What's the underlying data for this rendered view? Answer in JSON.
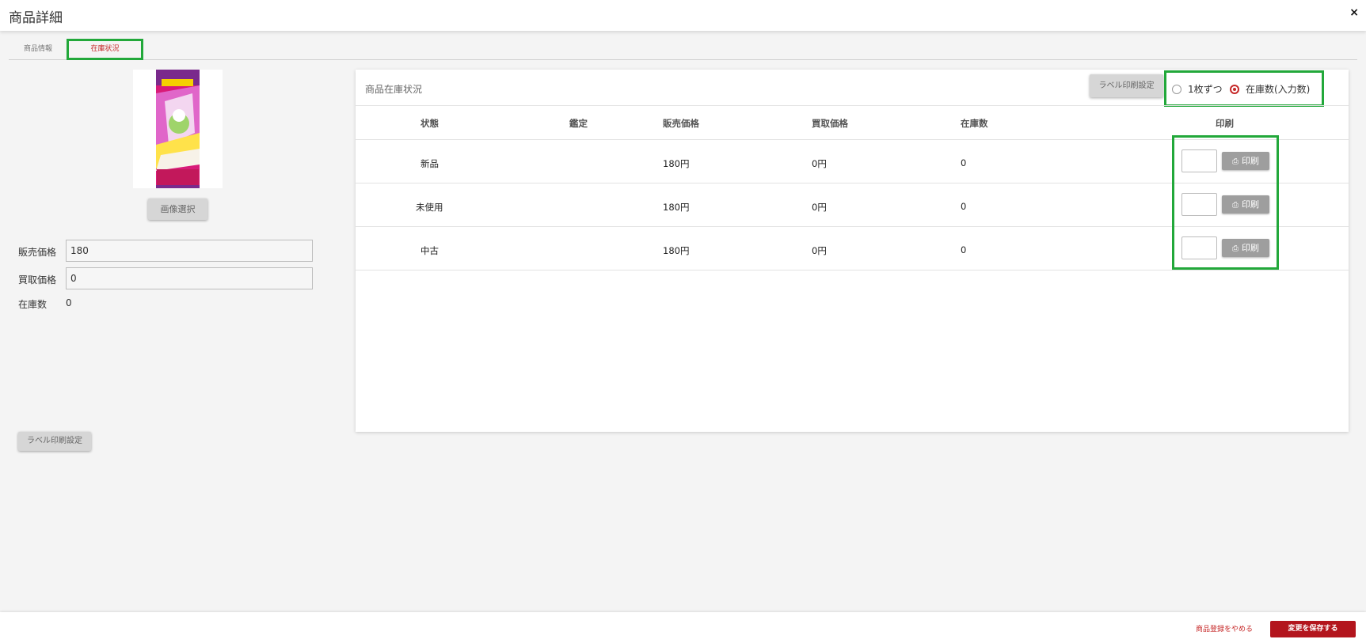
{
  "header": {
    "title": "商品詳細",
    "close_label": "×"
  },
  "tabs": [
    {
      "label": "商品情報",
      "active": false
    },
    {
      "label": "在庫状況",
      "active": true
    }
  ],
  "left": {
    "image_select_label": "画像選択",
    "sale_price_label": "販売価格",
    "sale_price_value": "180",
    "buy_price_label": "買取価格",
    "buy_price_value": "0",
    "stock_label": "在庫数",
    "stock_value": "0",
    "label_print_settings": "ラベル印刷設定"
  },
  "panel": {
    "title": "商品在庫状況",
    "label_print_settings": "ラベル印刷設定",
    "radio_options": [
      {
        "label": "1枚ずつ",
        "selected": false
      },
      {
        "label": "在庫数(入力数)",
        "selected": true
      }
    ],
    "columns": [
      "状態",
      "鑑定",
      "販売価格",
      "買取価格",
      "在庫数",
      "印刷"
    ],
    "rows": [
      {
        "condition": "新品",
        "appraisal": "",
        "sale_price": "180円",
        "buy_price": "0円",
        "stock": "0"
      },
      {
        "condition": "未使用",
        "appraisal": "",
        "sale_price": "180円",
        "buy_price": "0円",
        "stock": "0"
      },
      {
        "condition": "中古",
        "appraisal": "",
        "sale_price": "180円",
        "buy_price": "0円",
        "stock": "0"
      }
    ],
    "print_button_label": "印刷"
  },
  "footer": {
    "cancel_label": "商品登録をやめる",
    "save_label": "変更を保存する"
  },
  "colors": {
    "accent": "#b3151d",
    "highlight": "#22a83a"
  }
}
